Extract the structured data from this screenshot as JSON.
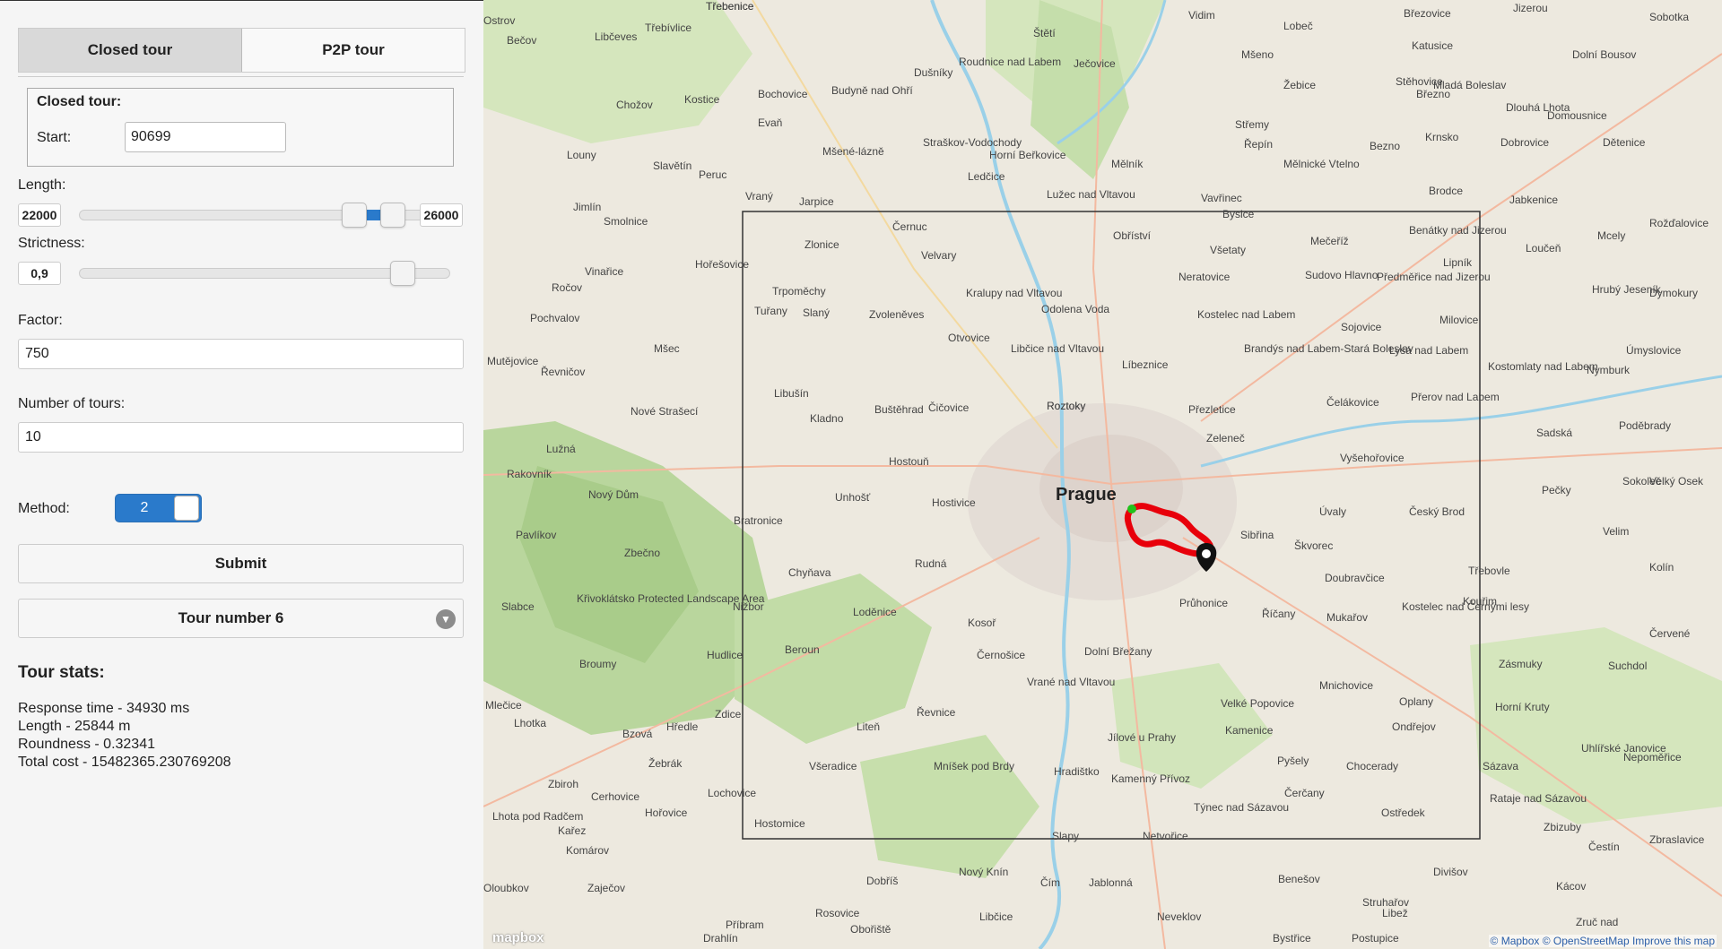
{
  "tabs": [
    {
      "label": "Closed tour",
      "active": true
    },
    {
      "label": "P2P tour",
      "active": false
    }
  ],
  "closed_tour": {
    "legend": "Closed tour:",
    "start_label": "Start:",
    "start_value": "90699"
  },
  "length": {
    "label": "Length:",
    "min_box": "22000",
    "max_box": "26000",
    "range_low_fraction": 0.76,
    "range_high_fraction": 0.87
  },
  "strictness": {
    "label": "Strictness:",
    "value_box": "0,9",
    "fraction": 0.9
  },
  "factor": {
    "label": "Factor:",
    "value": "750"
  },
  "num_tours": {
    "label": "Number of tours:",
    "value": "10"
  },
  "method": {
    "label": "Method:",
    "value": "2"
  },
  "submit_label": "Submit",
  "tour_select": {
    "selected": "Tour number 6"
  },
  "stats": {
    "title": "Tour stats:",
    "response_time": "Response time - 34930 ms",
    "length": "Length - 25844 m",
    "roundness": "Roundness - 0.32341",
    "total_cost": "Total cost - 15482365.230769208"
  },
  "map": {
    "colors": {
      "route": "#e8000b",
      "start": "#21c21b",
      "land": "#ede9df",
      "forest": "#cfe3b4",
      "water": "#9ad0e8"
    },
    "attribution": "© Mapbox © OpenStreetMap Improve this map",
    "logo": "mapbox",
    "city": "Prague",
    "labels": [
      "Třebenice",
      "Štětí",
      "Vidim",
      "Lobeč",
      "Březovice",
      "Jizerou",
      "Sobotka",
      "Bečov",
      "Libčeves",
      "Třebívlice",
      "Roudnice nad Labem",
      "Ječovice",
      "Katusice",
      "Bochovice",
      "Budyně nad Ohří",
      "Dušníky",
      "Mšeno",
      "Mladá Boleslav",
      "Dolní Bousov",
      "Chožov",
      "Kostice",
      "Evaň",
      "Stěhovice",
      "Střemy",
      "Žebice",
      "Březno",
      "Dlouhá Lhota",
      "Louny",
      "Slavětín",
      "Mšené-lázně",
      "Straškov-Vodochody",
      "Horní Beřkovice",
      "Mělník",
      "Řepín",
      "Bezno",
      "Domousnice",
      "Dětenice",
      "Peruc",
      "Ledčice",
      "Lužec nad Vltavou",
      "Vavřinec",
      "Mělnické Vtelno",
      "Krnsko",
      "Dobrovice",
      "Jimlín",
      "Vraný",
      "Jarpice",
      "Bysice",
      "Brodce",
      "Jabkenice",
      "Smolnice",
      "Zlonice",
      "Černuc",
      "Obříství",
      "Mečeříž",
      "Benátky nad Jizerou",
      "Mcely",
      "Rožďalovice",
      "Hořešovice",
      "Velvary",
      "Všetaty",
      "Sudovo Hlavno",
      "Lipník",
      "Loučeň",
      "Vinařice",
      "Neratovice",
      "Předměřice nad Jizerou",
      "Hrubý Jeseník",
      "Dymokury",
      "Ročov",
      "Trpoměchy",
      "Kralupy nad Vltavou",
      "Slaný",
      "Zvoleněves",
      "Odolena Voda",
      "Kostelec nad Labem",
      "Sojovice",
      "Milovice",
      "Pochvalov",
      "Tuřany",
      "Otvovice",
      "Libčice nad Vltavou",
      "Brandýs nad Labem-Stará Boleslav",
      "Lysá nad Labem",
      "Úmyslovice",
      "Mutějovice",
      "Mšec",
      "Líbeznice",
      "Kostomlaty nad Labem",
      "Nymburk",
      "Řevničov",
      "Libušín",
      "Buštěhrad",
      "Čičovice",
      "Roztoky",
      "Přezletice",
      "Čelákovice",
      "Přerov nad Labem",
      "Nové Strašecí",
      "Kladno",
      "Zeleneč",
      "Poděbrady",
      "Lužná",
      "Hostouň",
      "Vyšehořovice",
      "Sadská",
      "Rakovník",
      "Unhošť",
      "Hostivice",
      "Úvaly",
      "Český Brod",
      "Sokoleč",
      "Velký Osek",
      "Nový Dům",
      "Bratronice",
      "Sibřina",
      "Škvorec",
      "Pečky",
      "Pavlíkov",
      "Zbečno",
      "Velim",
      "Roztoky",
      "Chyňava",
      "Rudná",
      "Doubravčice",
      "Třebovle",
      "Kolín",
      "Slabce",
      "Křivoklátsko Protected Landscape Area",
      "Nižbor",
      "Loděnice",
      "Průhonice",
      "Říčany",
      "Mukařov",
      "Kostelec nad Černými lesy",
      "Kouřim",
      "Červené",
      "Beroun",
      "Kosoř",
      "Černošice",
      "Dolní Břežany",
      "Zásmuky",
      "Suchdol",
      "Broumy",
      "Hudlice",
      "Mnichovice",
      "Mlečice",
      "Zdice",
      "Velké Popovice",
      "Oplany",
      "Horní Kruty",
      "Lhotka",
      "Hředle",
      "Liteň",
      "Řevnice",
      "Vrané nad Vltavou",
      "Ondřejov",
      "Uhlířské Janovice",
      "Bzová",
      "Kamenice",
      "Jílové u Prahy",
      "Nepoměřice",
      "Žebrák",
      "Všeradice",
      "Mníšek pod Brdy",
      "Hradištko",
      "Pyšely",
      "Chocerady",
      "Sázava",
      "Zbiroh",
      "Cerhovice",
      "Lochovice",
      "Hořovice",
      "Kamenný Přívoz",
      "Týnec nad Sázavou",
      "Čerčany",
      "Ratajе nad Sázavou",
      "Lhota pod Radčem",
      "Kařez",
      "Hostomice",
      "Třebenice",
      "Slapy",
      "Netvořice",
      "Ostředek",
      "Zbizuby",
      "Zbraslavice",
      "Komárov",
      "Čestín",
      "Zaječov",
      "Dobříš",
      "Nový Knín",
      "Čím",
      "Jablonná",
      "Benešov",
      "Divišov",
      "Kácov",
      "Oloubkov",
      "Struhařov",
      "Rosovice",
      "Libčice",
      "Neveklov",
      "Libež",
      "Příbram",
      "Obořiště",
      "Zruč nad",
      "Drahlín",
      "Bystřice",
      "Postupice",
      "Ostrov"
    ]
  }
}
